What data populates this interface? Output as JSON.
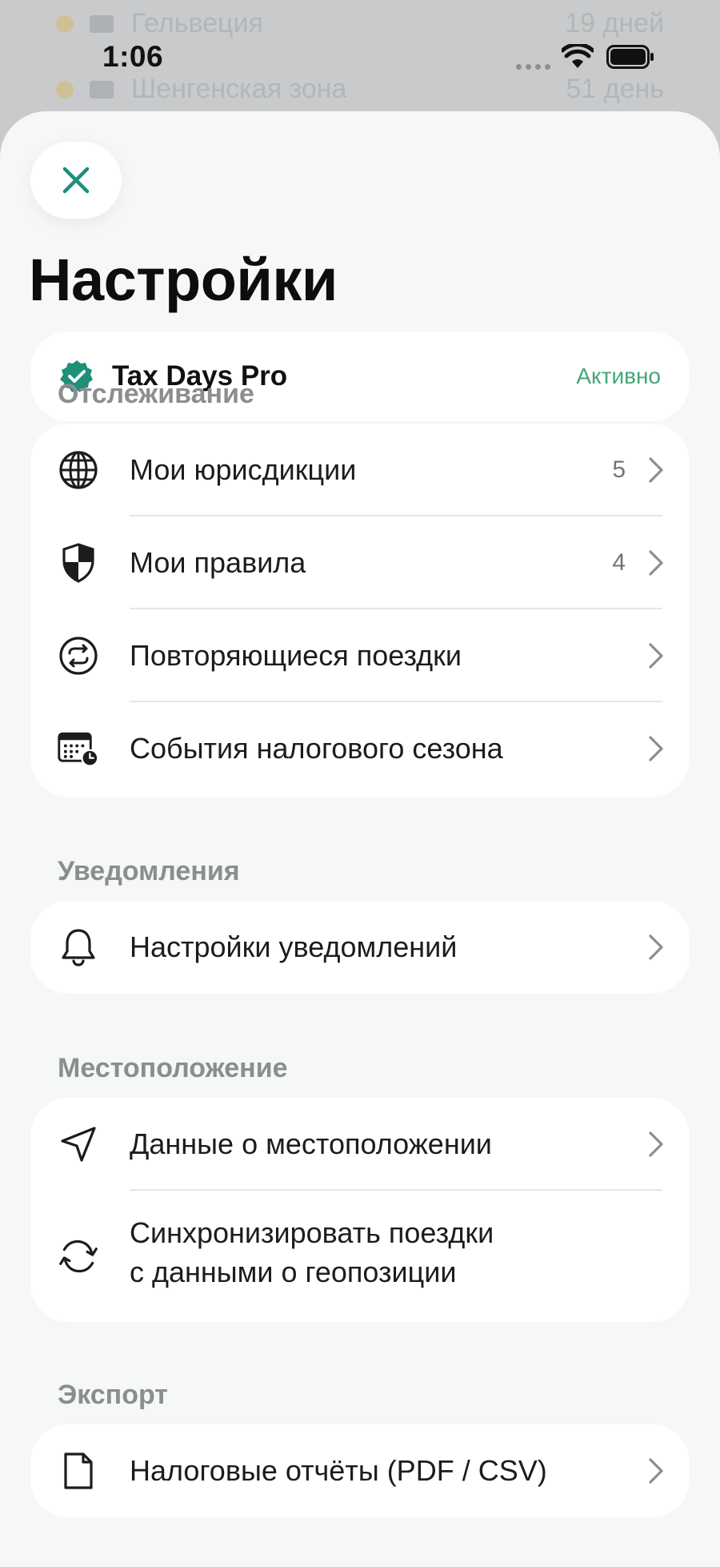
{
  "status_bar": {
    "time": "1:06"
  },
  "background_list": [
    {
      "label": "Гельвеция",
      "value": "19 дней"
    },
    {
      "label": "Шенгенская зона",
      "value": "51 день"
    }
  ],
  "header": {
    "title": "Настройки"
  },
  "subscription": {
    "name": "Tax Days Pro",
    "status": "Активно"
  },
  "sections": {
    "tracking": {
      "title": "Отслеживание",
      "items": [
        {
          "label": "Мои юрисдикции",
          "count": "5",
          "icon": "globe-icon"
        },
        {
          "label": "Мои правила",
          "count": "4",
          "icon": "shield-icon"
        },
        {
          "label": "Повторяющиеся поездки",
          "icon": "repeat-icon"
        },
        {
          "label": "События налогового сезона",
          "icon": "calendar-clock-icon"
        }
      ]
    },
    "notifications": {
      "title": "Уведомления",
      "items": [
        {
          "label": "Настройки уведомлений",
          "icon": "bell-icon"
        }
      ]
    },
    "location": {
      "title": "Местоположение",
      "items": [
        {
          "label": "Данные о местоположении",
          "icon": "location-arrow-icon"
        },
        {
          "label_line1": "Синхронизировать поездки",
          "label_line2": "с данными о геопозиции",
          "icon": "sync-icon"
        }
      ]
    },
    "export": {
      "title": "Экспорт",
      "items": [
        {
          "label": "Налоговые отчёты (PDF / CSV)",
          "icon": "document-icon"
        }
      ]
    }
  },
  "colors": {
    "accent": "#1f8f7a",
    "active_status": "#42a876",
    "sheet_bg": "#f6f7f7"
  }
}
